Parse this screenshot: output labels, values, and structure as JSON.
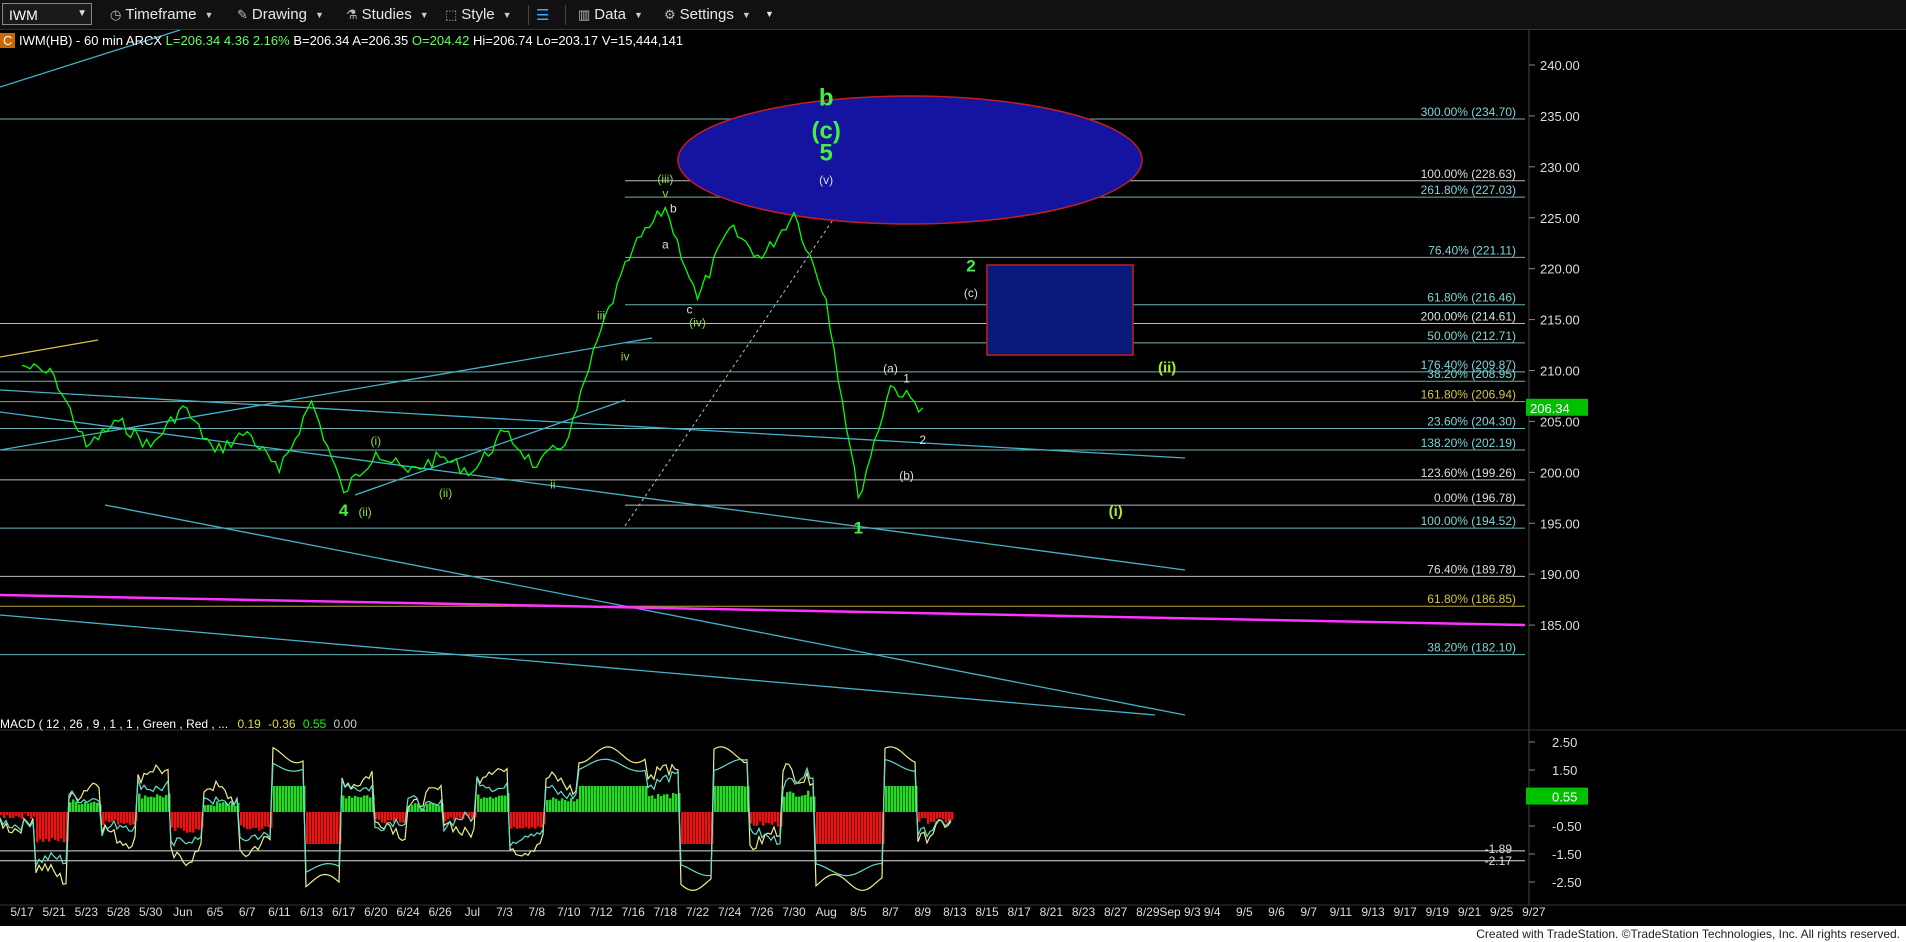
{
  "toolbar": {
    "symbol": "IWM",
    "items": [
      "Timeframe",
      "Drawing",
      "Studies",
      "Style",
      "Data",
      "Settings"
    ]
  },
  "info": {
    "badge": "C",
    "desc": "IWM(HB) - 60 min  ARCX",
    "last": "L=206.34",
    "chg": "4.36",
    "pct": "2.16%",
    "bid": "B=206.34",
    "ask": "A=206.35",
    "open": "O=204.42",
    "high": "Hi=206.74",
    "low": "Lo=203.17",
    "vol": "V=15,444,141"
  },
  "macd_header": {
    "label": "MACD ( 12 , 26 , 9 , 1 , 1 , Green , Red , ...",
    "v1": "0.19",
    "v2": "-0.36",
    "v3": "0.55",
    "v4": "0.00"
  },
  "footer": "Created with TradeStation. ©TradeStation Technologies, Inc. All rights reserved.",
  "colors": {
    "price": "#00ff00",
    "fib": "#7fd4d4",
    "gold": "#d4c44a",
    "magenta": "#ff33ff",
    "trend": "#46b0c8",
    "ellipse": "#1414a0",
    "box": "#0a1a7a",
    "wave_green": "#44ee44",
    "wave_lime": "#aaee22"
  },
  "chart_data": {
    "type": "line",
    "title": "IWM(HB) - 60 min",
    "price_axis": {
      "min": 180,
      "max": 240,
      "ticks": [
        240,
        235,
        230,
        225,
        220,
        215,
        210,
        205,
        200,
        195,
        190,
        185
      ]
    },
    "last_price": 206.34,
    "date_axis": [
      "5/17",
      "5/21",
      "5/23",
      "5/28",
      "5/30",
      "Jun",
      "6/5",
      "6/7",
      "6/11",
      "6/13",
      "6/17",
      "6/20",
      "6/24",
      "6/26",
      "Jul",
      "7/3",
      "7/8",
      "7/10",
      "7/12",
      "7/16",
      "7/18",
      "7/22",
      "7/24",
      "7/26",
      "7/30",
      "Aug",
      "8/5",
      "8/7",
      "8/9",
      "8/13",
      "8/15",
      "8/17",
      "8/21",
      "8/23",
      "8/27",
      "8/29",
      "Sep 9/3",
      "9/4",
      "9/5",
      "9/6",
      "9/7",
      "9/11",
      "9/13",
      "9/17",
      "9/19",
      "9/21",
      "9/25",
      "9/27"
    ],
    "price_series": [
      {
        "date": "5/17",
        "close": 210.5
      },
      {
        "date": "5/21",
        "close": 209.5
      },
      {
        "date": "5/23",
        "close": 202.5
      },
      {
        "date": "5/28",
        "close": 205.0
      },
      {
        "date": "5/30",
        "close": 202.5
      },
      {
        "date": "Jun",
        "close": 206.5
      },
      {
        "date": "6/5",
        "close": 202.0
      },
      {
        "date": "6/7",
        "close": 204.0
      },
      {
        "date": "6/11",
        "close": 200.0
      },
      {
        "date": "6/13",
        "close": 207.0
      },
      {
        "date": "6/17",
        "close": 198.0
      },
      {
        "date": "6/20",
        "close": 202.0
      },
      {
        "date": "6/24",
        "close": 200.0
      },
      {
        "date": "6/26",
        "close": 201.5
      },
      {
        "date": "Jul",
        "close": 200.0
      },
      {
        "date": "7/3",
        "close": 204.0
      },
      {
        "date": "7/8",
        "close": 200.5
      },
      {
        "date": "7/10",
        "close": 203.5
      },
      {
        "date": "7/12",
        "close": 214.0
      },
      {
        "date": "7/16",
        "close": 222.0
      },
      {
        "date": "7/18",
        "close": 226.0
      },
      {
        "date": "7/22",
        "close": 217.0
      },
      {
        "date": "7/24",
        "close": 224.0
      },
      {
        "date": "7/26",
        "close": 221.0
      },
      {
        "date": "7/30",
        "close": 225.5
      },
      {
        "date": "Aug",
        "close": 217.0
      },
      {
        "date": "8/5",
        "close": 197.5
      },
      {
        "date": "8/7",
        "close": 208.5
      },
      {
        "date": "8/9",
        "close": 206.34
      }
    ],
    "fib_levels": [
      {
        "label": "300.00%",
        "value": 234.7
      },
      {
        "label": "100.00%",
        "value": 228.63
      },
      {
        "label": "261.80%",
        "value": 227.03
      },
      {
        "label": "76.40%",
        "value": 221.11
      },
      {
        "label": "61.80%",
        "value": 216.46
      },
      {
        "label": "200.00%",
        "value": 214.61
      },
      {
        "label": "50.00%",
        "value": 212.71
      },
      {
        "label": "176.40%",
        "value": 209.87
      },
      {
        "label": "38.20%",
        "value": 208.95
      },
      {
        "label": "161.80%",
        "value": 206.94
      },
      {
        "label": "23.60%",
        "value": 204.3
      },
      {
        "label": "138.20%",
        "value": 202.19
      },
      {
        "label": "123.60%",
        "value": 199.26
      },
      {
        "label": "0.00%",
        "value": 196.78
      },
      {
        "label": "100.00%",
        "value": 194.52
      },
      {
        "label": "76.40%",
        "value": 189.78
      },
      {
        "label": "61.80%",
        "value": 186.85
      },
      {
        "label": "38.20%",
        "value": 182.1
      }
    ],
    "wave_labels": [
      {
        "text": "b",
        "date": "8/1",
        "price": 236.0
      },
      {
        "text": "(c)",
        "date": "8/1",
        "price": 232.8
      },
      {
        "text": "5",
        "date": "8/1",
        "price": 230.6
      },
      {
        "text": "(v)",
        "date": "8/1",
        "price": 228.3
      },
      {
        "text": "(iii)",
        "date": "7/18",
        "price": 228.4
      },
      {
        "text": "v",
        "date": "7/18",
        "price": 227.0
      },
      {
        "text": "b",
        "date": "7/19",
        "price": 225.5
      },
      {
        "text": "a",
        "date": "7/18",
        "price": 222.0
      },
      {
        "text": "c",
        "date": "7/21",
        "price": 215.6
      },
      {
        "text": "(iv)",
        "date": "7/22",
        "price": 214.3
      },
      {
        "text": "iii",
        "date": "7/12",
        "price": 215.0
      },
      {
        "text": "iv",
        "date": "7/15",
        "price": 211.0
      },
      {
        "text": "1",
        "date": "8/5",
        "price": 194.0
      },
      {
        "text": "(a)",
        "date": "8/7",
        "price": 209.8
      },
      {
        "text": "1",
        "date": "8/8",
        "price": 208.8
      },
      {
        "text": "2",
        "date": "8/9",
        "price": 202.8
      },
      {
        "text": "(b)",
        "date": "8/8",
        "price": 199.3
      },
      {
        "text": "2",
        "date": "8/14",
        "price": 219.7
      },
      {
        "text": "(c)",
        "date": "8/14",
        "price": 217.2
      },
      {
        "text": "(ii)",
        "date": "9/1",
        "price": 209.8
      },
      {
        "text": "(i)",
        "date": "8/27",
        "price": 195.7
      },
      {
        "text": "4",
        "date": "6/17",
        "price": 195.7
      },
      {
        "text": "(ii)",
        "date": "6/19",
        "price": 195.7
      },
      {
        "text": "(i)",
        "date": "6/20",
        "price": 202.7
      },
      {
        "text": "(ii)",
        "date": "6/27",
        "price": 197.6
      },
      {
        "text": "ii",
        "date": "7/9",
        "price": 198.4
      }
    ],
    "macd": {
      "y_axis_ticks": [
        2.5,
        1.5,
        0.5,
        -0.5,
        -1.5,
        -2.5
      ],
      "macd_value": 0.19,
      "signal_value": -0.36,
      "histogram_value": 0.55,
      "zero": 0.0,
      "extra_ticks": [
        -1.89,
        -2.17
      ]
    }
  }
}
